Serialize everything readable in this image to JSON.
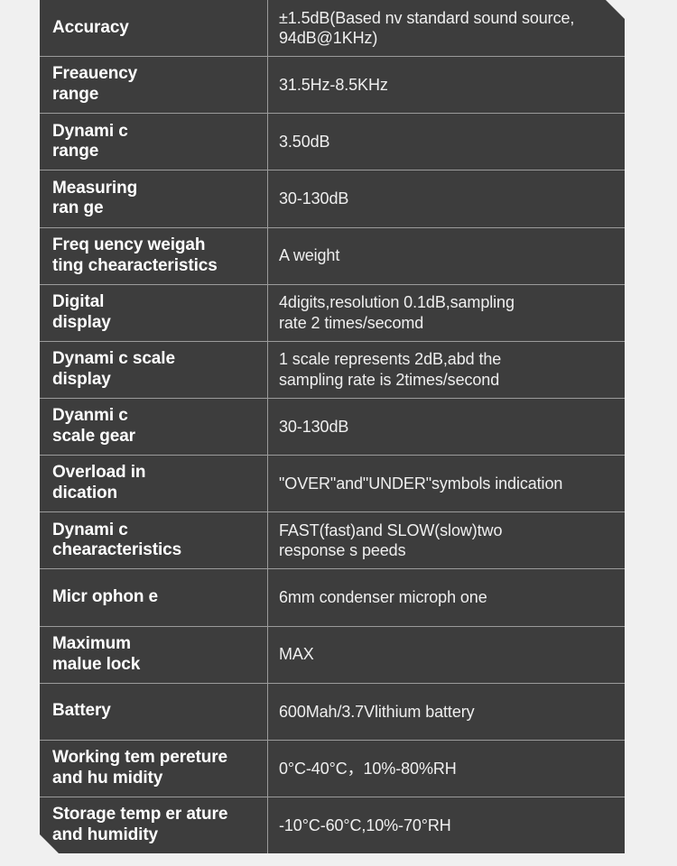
{
  "page": {
    "background_color": "#f0f0f0",
    "table_background_color": "#3d3d3d",
    "divider_color": "#9b9b9b",
    "label_text_color": "#ffffff",
    "value_text_color": "#efefef"
  },
  "spec_table": {
    "rows": [
      {
        "label": "Accuracy",
        "value": "±1.5dB(Based nv standard sound source,\n94dB@1KHz)"
      },
      {
        "label": "Freauency\nrange",
        "value": "31.5Hz-8.5KHz"
      },
      {
        "label": "Dynami c\nrange",
        "value": "3.50dB"
      },
      {
        "label": "Measuring\nran ge",
        "value": "30-130dB"
      },
      {
        "label": "Freq uency weigah\nting chearacteristics",
        "value": "A weight"
      },
      {
        "label": "Digital\ndisplay",
        "value": "4digits,resolution 0.1dB,sampling\nrate 2 times/secomd"
      },
      {
        "label": "Dynami c scale\ndisplay",
        "value": "1 scale represents 2dB,abd the\nsampling rate is 2times/second"
      },
      {
        "label": "Dyanmi c\nscale gear",
        "value": "30-130dB"
      },
      {
        "label": "Overload in\ndication",
        "value": "\"OVER\"and\"UNDER\"symbols indication"
      },
      {
        "label": "Dynami c\nchearacteristics",
        "value": "FAST(fast)and SLOW(slow)two\nresponse s peeds"
      },
      {
        "label": "Micr ophon e",
        "value": "6mm condenser microph one"
      },
      {
        "label": "Maximum\nmalue lock",
        "value": "MAX"
      },
      {
        "label": "Battery",
        "value": "600Mah/3.7Vlithium battery"
      },
      {
        "label": "Working tem pereture\n and hu midity",
        "value": "0°C-40°C，10%-80%RH"
      },
      {
        "label": "Storage temp er ature\nand humidity",
        "value": "-10°C-60°C,10%-70°RH"
      }
    ]
  }
}
